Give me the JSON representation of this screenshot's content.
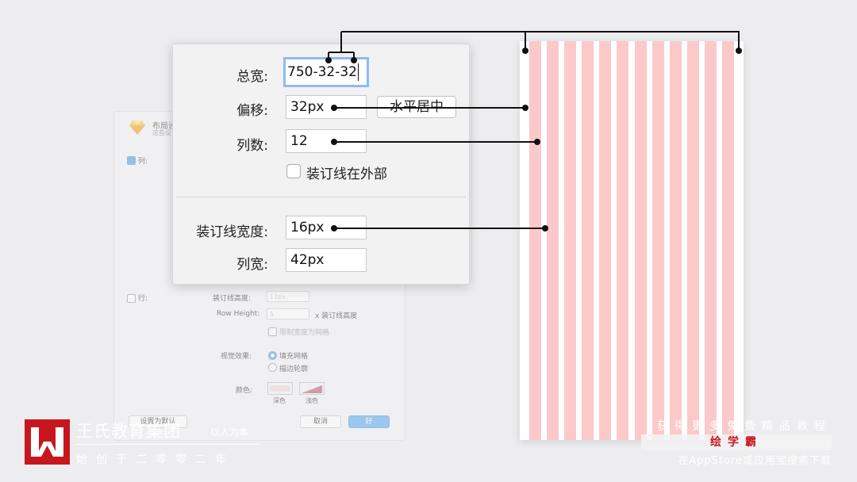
{
  "bg_dialog": {
    "title": "布局设",
    "subtitle": "这些设",
    "columns_label": "列:",
    "rows_label": "行:",
    "gutter_height_label": "装订线高度:",
    "gutter_height_value": "12px",
    "row_height_label": "Row Height:",
    "row_height_value": "5",
    "row_height_suffix": "x 装订线高度",
    "fit_label": "限制宽度为网格",
    "visual_label": "视觉效果:",
    "fill_option": "填充网格",
    "stroke_option": "描边轮廓",
    "color_label": "颜色:",
    "dark_label": "深色",
    "light_label": "浅色",
    "default_button": "设置为默认",
    "cancel_button": "取消",
    "ok_button": "好",
    "dark_color": "#f4d4d6",
    "light_color": "#b0606a"
  },
  "fg_dialog": {
    "total_width_label": "总宽:",
    "total_width_value": "750-32-32",
    "offset_label": "偏移:",
    "offset_value": "32px",
    "center_button": "水平居中",
    "columns_label": "列数:",
    "columns_value": "12",
    "gutter_outside_label": "装订线在外部",
    "gutter_width_label": "装订线宽度:",
    "gutter_width_value": "16px",
    "column_width_label": "列宽:",
    "column_width_value": "42px"
  },
  "grid": {
    "column_count": 12,
    "column_color": "#fcc9ca"
  },
  "brand": {
    "logo_letter": "W",
    "title": "王氏教育集团",
    "slogan": "以人为本",
    "founded": "始创于二零零二年",
    "promo_top": "获得更多免费精品教程",
    "promo_name": "绘学霸",
    "promo_bottom": "在AppStore或应用宝搜索下载",
    "brand_color": "#c8161e"
  }
}
